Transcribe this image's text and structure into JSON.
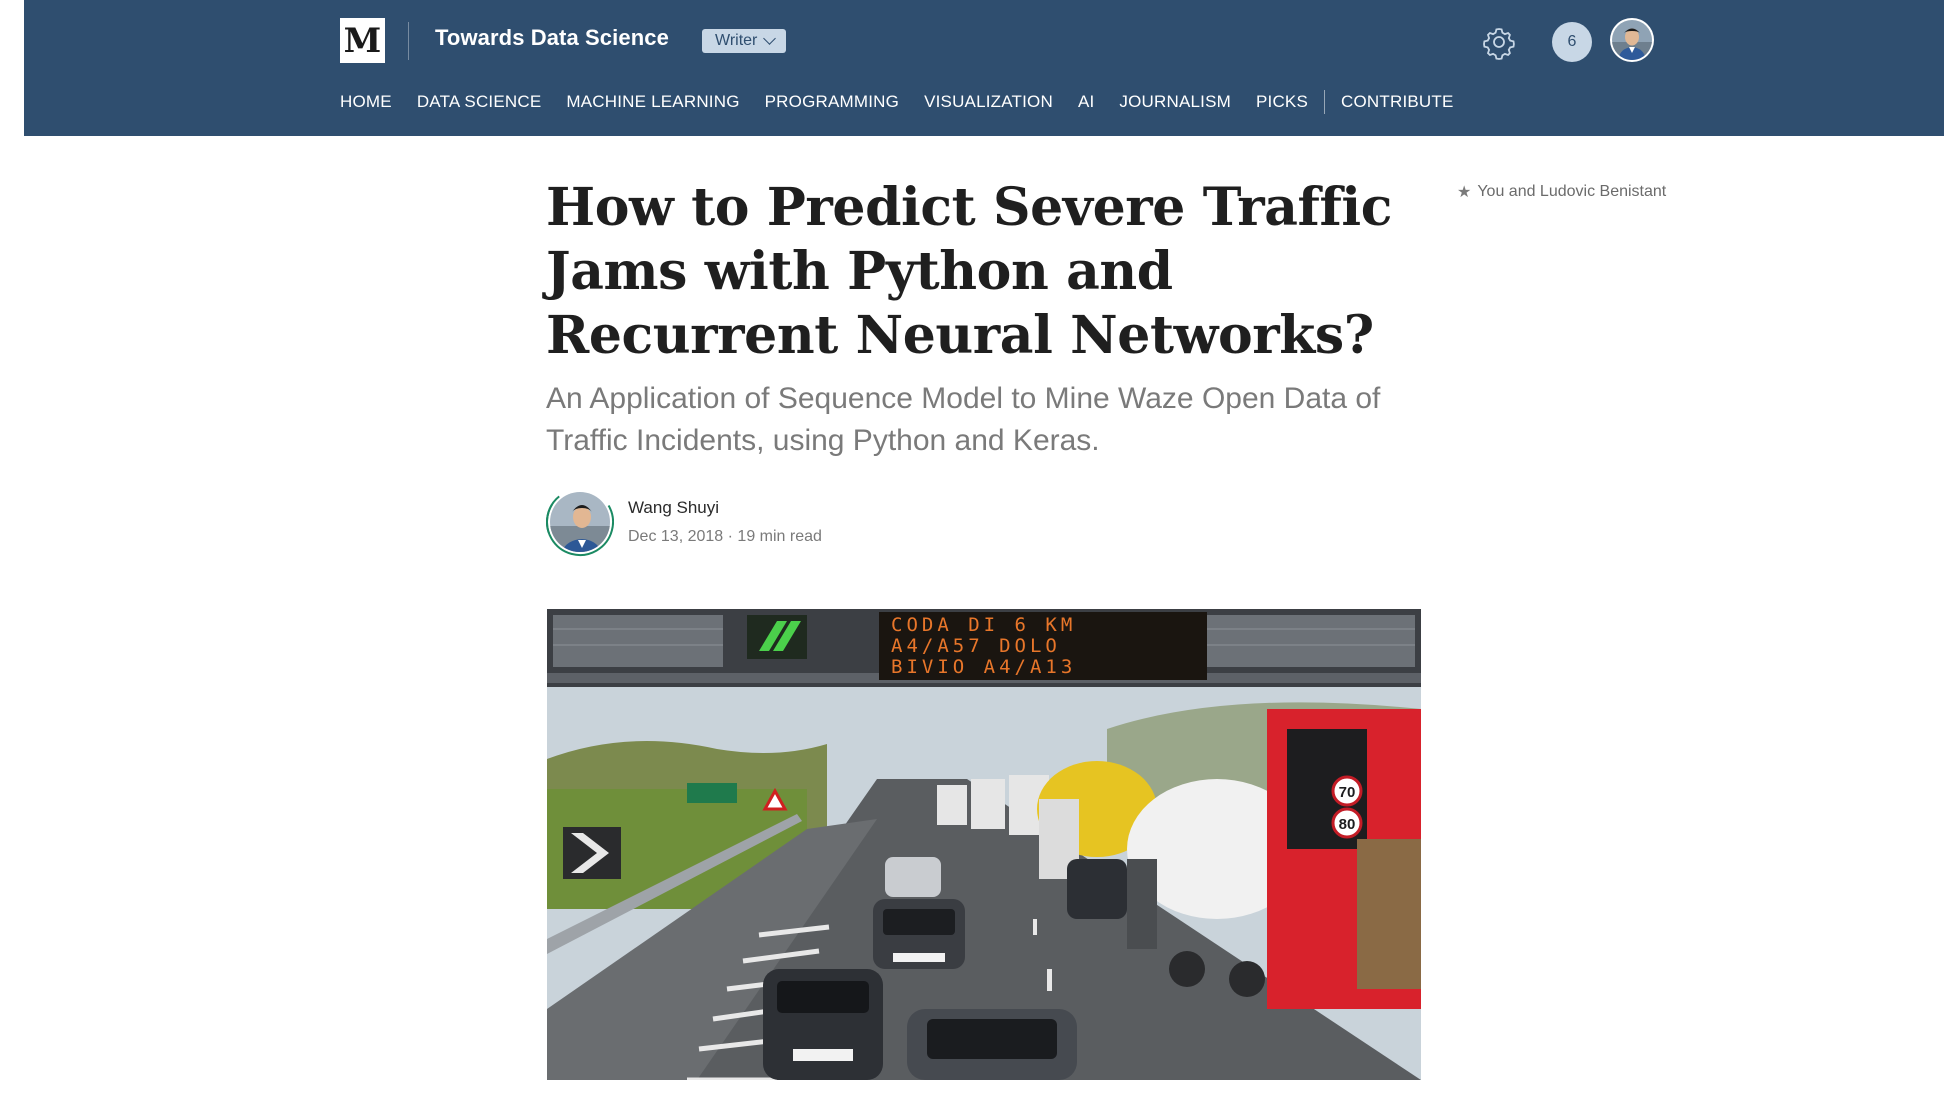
{
  "header": {
    "logo_letter": "M",
    "publication": "Towards Data Science",
    "writer_badge": "Writer",
    "notifications_count": "6",
    "nav": [
      "HOME",
      "DATA SCIENCE",
      "MACHINE LEARNING",
      "PROGRAMMING",
      "VISUALIZATION",
      "AI",
      "JOURNALISM",
      "PICKS",
      "CONTRIBUTE"
    ],
    "colors": {
      "bar": "#2f4e6f",
      "badge": "#c8d7e6"
    }
  },
  "article": {
    "title": "How to Predict Severe Traffic Jams with Python and Recurrent Neural Networks?",
    "subtitle": "An Application of Sequence Model to Mine Waze Open Data of Traffic Incidents, using Python and Keras.",
    "author": "Wang Shuyi",
    "date": "Dec 13, 2018",
    "separator": "·",
    "read_time": "19 min read",
    "side_note": "You and Ludovic Benistant"
  },
  "hero_image": {
    "sign_lines": [
      "CODA DI 6 KM",
      "A4/A57 DOLO",
      "BIVIO A4/A13"
    ],
    "speed_signs": [
      "70",
      "80"
    ]
  }
}
